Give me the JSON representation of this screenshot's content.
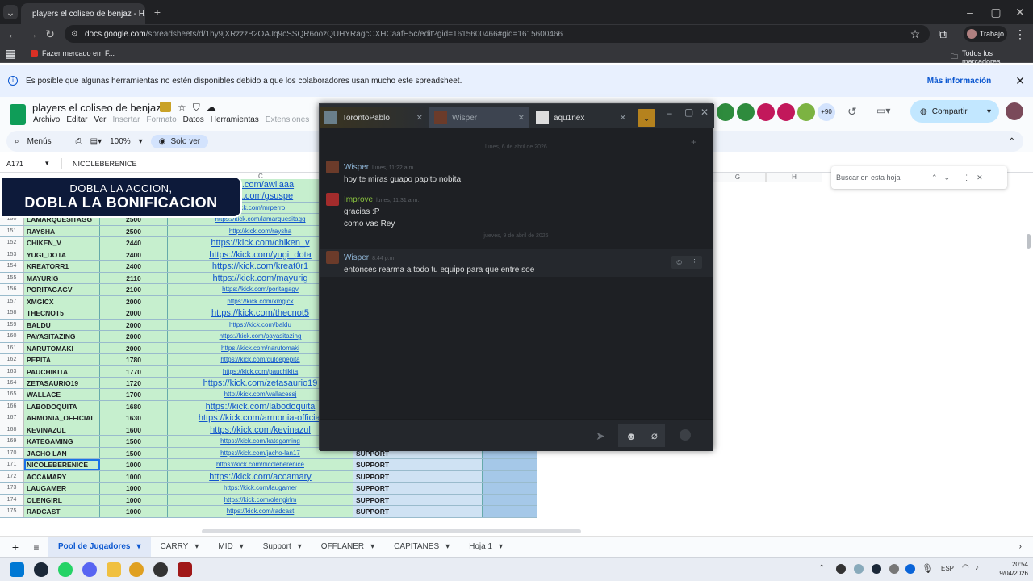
{
  "browser": {
    "tab_title": "players el coliseo de benjaz - H...",
    "url_host": "docs.google.com",
    "url_path": "/spreadsheets/d/1hy9jXRzzzB2OAJq9cSSQR6oozQUHYRagcCXHCaafH5c/edit?gid=1615600466#gid=1615600466",
    "profile_label": "Trabajo",
    "bookmark_1": "Fazer mercado em F...",
    "bookmarks_folder": "Todos los marcadores"
  },
  "notice": {
    "text": "Es posible que algunas herramientas no estén disponibles debido a que los colaboradores usan mucho este spreadsheet.",
    "link": "Más información"
  },
  "doc": {
    "title": "players el coliseo de benjaz",
    "menus": [
      "Archivo",
      "Editar",
      "Ver",
      "Insertar",
      "Formato",
      "Datos",
      "Herramientas",
      "Extensiones"
    ],
    "share_label": "Compartir",
    "collab_count": "+90"
  },
  "toolbar": {
    "menus_label": "Menús",
    "zoom": "100%",
    "mode": "Solo ver"
  },
  "formula": {
    "cell_ref": "A171",
    "value": "NICOLEBERENICE"
  },
  "columns": {
    "c": "C",
    "g": "G",
    "h": "H"
  },
  "search": {
    "placeholder": "Buscar en esta hoja"
  },
  "banner": {
    "line1": "DOBLA LA ACCION,",
    "line2": "DOBLA LA BONIFICACION"
  },
  "rows": [
    {
      "n": "",
      "name": "",
      "val": "",
      "url": "kick.com/awilaaa",
      "role": "",
      "big": true
    },
    {
      "n": "",
      "name": "",
      "val": "",
      "url": "kick.com/gsuspe",
      "role": "",
      "big": true
    },
    {
      "n": "",
      "name": "",
      "val": "",
      "url": "kick.com/mrperro",
      "role": "",
      "big": false
    },
    {
      "n": "150",
      "name": "LAMARQUESITAGG",
      "val": "2500",
      "url": "https://kick.com/lamarquesitagg",
      "role": "",
      "big": false
    },
    {
      "n": "151",
      "name": "RAYSHA",
      "val": "2500",
      "url": "http://kick.com/raysha",
      "role": "",
      "big": false
    },
    {
      "n": "152",
      "name": "CHIKEN_V",
      "val": "2440",
      "url": "https://kick.com/chiken_v",
      "role": "",
      "big": true
    },
    {
      "n": "153",
      "name": "YUGI_DOTA",
      "val": "2400",
      "url": "https://kick.com/yugi_dota",
      "role": "",
      "big": true
    },
    {
      "n": "154",
      "name": "KREATORR1",
      "val": "2400",
      "url": "https://kick.com/kreat0r1",
      "role": "",
      "big": true
    },
    {
      "n": "155",
      "name": "MAYURIG",
      "val": "2110",
      "url": "https://kick.com/mayurig",
      "role": "",
      "big": true
    },
    {
      "n": "156",
      "name": "PORITAGAGV",
      "val": "2100",
      "url": "https://kick.com/poritagagv",
      "role": "",
      "big": false
    },
    {
      "n": "157",
      "name": "XMGICX",
      "val": "2000",
      "url": "https://kick.com/xmgicx",
      "role": "",
      "big": false
    },
    {
      "n": "158",
      "name": "THECNOT5",
      "val": "2000",
      "url": "https://kick.com/thecnot5",
      "role": "",
      "big": true
    },
    {
      "n": "159",
      "name": "BALDU",
      "val": "2000",
      "url": "https://kick.com/baldu",
      "role": "",
      "big": false
    },
    {
      "n": "160",
      "name": "PAYASITAZING",
      "val": "2000",
      "url": "https://kick.com/payasitazing",
      "role": "",
      "big": false
    },
    {
      "n": "161",
      "name": "NARUTOMAKI",
      "val": "2000",
      "url": "https://kick.com/narutomaki",
      "role": "",
      "big": false
    },
    {
      "n": "162",
      "name": "PEPITA",
      "val": "1780",
      "url": "https://kick.com/dulcepepita",
      "role": "",
      "big": false
    },
    {
      "n": "163",
      "name": "PAUCHIKITA",
      "val": "1770",
      "url": "https://kick.com/pauchikita",
      "role": "",
      "big": false
    },
    {
      "n": "164",
      "name": "ZETASAURIO19",
      "val": "1720",
      "url": "https://kick.com/zetasaurio19",
      "role": "",
      "big": true
    },
    {
      "n": "165",
      "name": "WALLACE",
      "val": "1700",
      "url": "http://kick.com/wallacessj",
      "role": "",
      "big": false
    },
    {
      "n": "166",
      "name": "LABODOQUITA",
      "val": "1680",
      "url": "https://kick.com/labodoquita",
      "role": "",
      "big": true
    },
    {
      "n": "167",
      "name": "ARMONIA_OFFICIAL",
      "val": "1630",
      "url": "https://kick.com/armonia-official",
      "role": "",
      "big": true
    },
    {
      "n": "168",
      "name": "KEVINAZUL",
      "val": "1600",
      "url": "https://kick.com/kevinazul",
      "role": "",
      "big": true
    },
    {
      "n": "169",
      "name": "KATEGAMING",
      "val": "1500",
      "url": "https://kick.com/kategaming",
      "role": "SUPPORT",
      "big": false
    },
    {
      "n": "170",
      "name": "JACHO LAN",
      "val": "1500",
      "url": "https://kick.com/jacho-lan17",
      "role": "SUPPORT",
      "big": false
    },
    {
      "n": "171",
      "name": "NICOLEBERENICE",
      "val": "1000",
      "url": "https://kick.com/nicoleberenice",
      "role": "SUPPORT",
      "big": false
    },
    {
      "n": "172",
      "name": "ACCAMARY",
      "val": "1000",
      "url": "https://kick.com/accamary",
      "role": "SUPPORT",
      "big": true
    },
    {
      "n": "173",
      "name": "LAUGAMER",
      "val": "1000",
      "url": "https://kick.com/laugamer",
      "role": "SUPPORT",
      "big": false
    },
    {
      "n": "174",
      "name": "OLENGIRL",
      "val": "1000",
      "url": "https://kick.com/olengirlm",
      "role": "SUPPORT",
      "big": false
    },
    {
      "n": "175",
      "name": "RADCAST",
      "val": "1000",
      "url": "https://kick.com/radcast",
      "role": "SUPPORT",
      "big": false
    }
  ],
  "chat": {
    "tabs": [
      "TorontoPablo",
      "Wisper",
      "aqu1nex"
    ],
    "day1": "lunes, 6 de abril de 2026",
    "day2": "jueves, 9 de abril de 2026",
    "messages": [
      {
        "name": "Wisper",
        "time": "lunes, 11:22 a.m.",
        "lines": [
          "hoy te miras guapo papito nobita"
        ],
        "color": "#8fb5d6"
      },
      {
        "name": "Improve",
        "time": "lunes, 11:31 a.m.",
        "lines": [
          "gracias :P",
          "como vas Rey"
        ],
        "color": "#8bc53f"
      },
      {
        "name": "Wisper",
        "time": "8:44 p.m.",
        "lines": [
          "entonces rearma a todo tu equipo para que entre soe"
        ],
        "color": "#8fb5d6"
      }
    ]
  },
  "sheet_tabs": [
    "Pool de Jugadores",
    "CARRY",
    "MID",
    "Support",
    "OFFLANER",
    "CAPITANES",
    "Hoja 1"
  ],
  "taskbar": {
    "lang": "ESP",
    "time": "20:54",
    "date": "9/04/2026"
  }
}
